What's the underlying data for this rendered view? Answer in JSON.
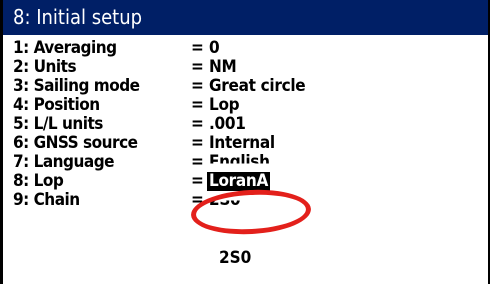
{
  "header": {
    "title": "8: Initial setup"
  },
  "menu": {
    "items": [
      {
        "label": "1: Averaging",
        "eq": "=",
        "value": "0"
      },
      {
        "label": "2: Units",
        "eq": "=",
        "value": "NM"
      },
      {
        "label": "3: Sailing mode",
        "eq": "=",
        "value": "Great circle"
      },
      {
        "label": "4: Position",
        "eq": "=",
        "value": "Lop"
      },
      {
        "label": "5: L/L units",
        "eq": "=",
        "value": ".001"
      },
      {
        "label": "6: GNSS source",
        "eq": "=",
        "value": "Internal"
      },
      {
        "label": "7: Language",
        "eq": "=",
        "value": "English"
      },
      {
        "label": "8: Lop",
        "eq": "=",
        "value": "LoranA"
      },
      {
        "label": "9: Chain",
        "eq": "=",
        "value": "2S0"
      }
    ],
    "dropdown_option_below": "2S0"
  },
  "colors": {
    "header_bg": "#001f66",
    "header_text": "#ffffff",
    "highlight_ring": "#e3201b",
    "selected_bg": "#000000",
    "selected_text": "#ffffff"
  }
}
